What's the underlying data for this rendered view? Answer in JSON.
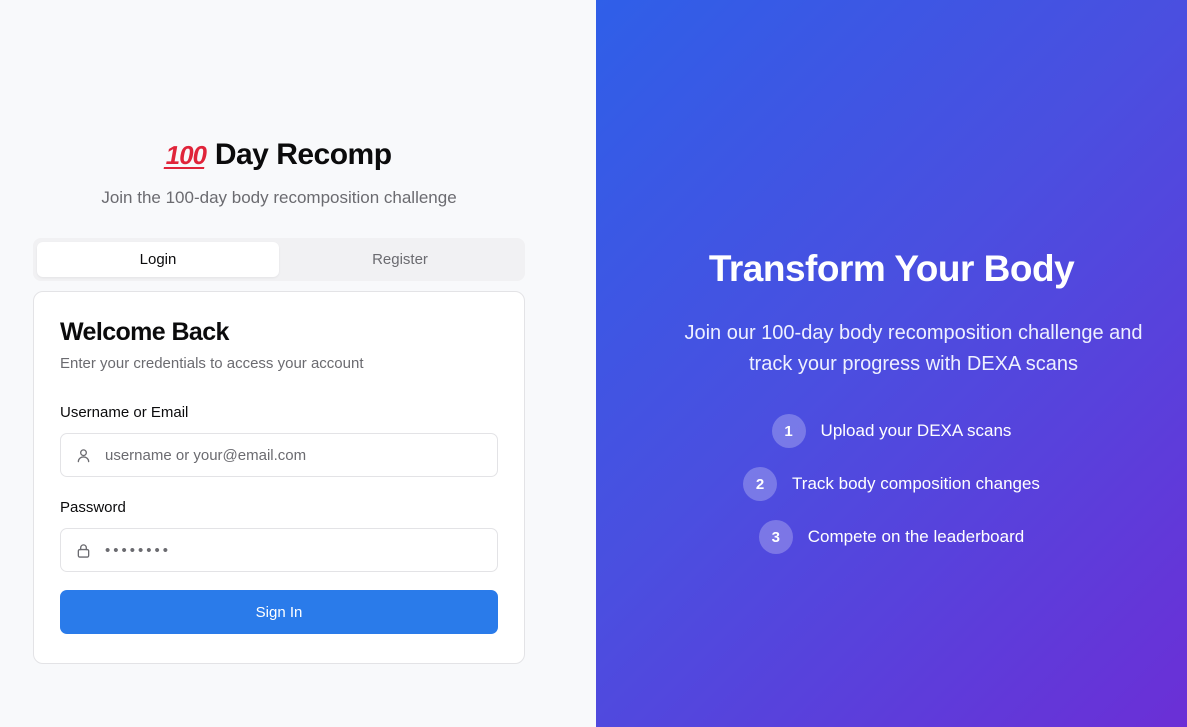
{
  "brand": {
    "emoji": "100",
    "title": "Day Recomp",
    "tagline": "Join the 100-day body recomposition challenge"
  },
  "tabs": [
    {
      "label": "Login",
      "active": true
    },
    {
      "label": "Register",
      "active": false
    }
  ],
  "card": {
    "title": "Welcome Back",
    "subtitle": "Enter your credentials to access your account",
    "username_label": "Username or Email",
    "username_placeholder": "username or your@email.com",
    "password_label": "Password",
    "password_value": "••••••••",
    "submit_label": "Sign In"
  },
  "hero": {
    "title": "Transform Your Body",
    "subtitle": "Join our 100-day body recomposition challenge and track your progress with DEXA scans",
    "steps": [
      {
        "number": "1",
        "text": "Upload your DEXA scans"
      },
      {
        "number": "2",
        "text": "Track body composition changes"
      },
      {
        "number": "3",
        "text": "Compete on the leaderboard"
      }
    ]
  },
  "colors": {
    "primary": "#2a7bea",
    "gradient_start": "#2f5fe8",
    "gradient_end": "#6b2fd6"
  },
  "icons": {
    "username": "user-icon",
    "password": "lock-icon",
    "brand": "hundred-points-icon"
  }
}
